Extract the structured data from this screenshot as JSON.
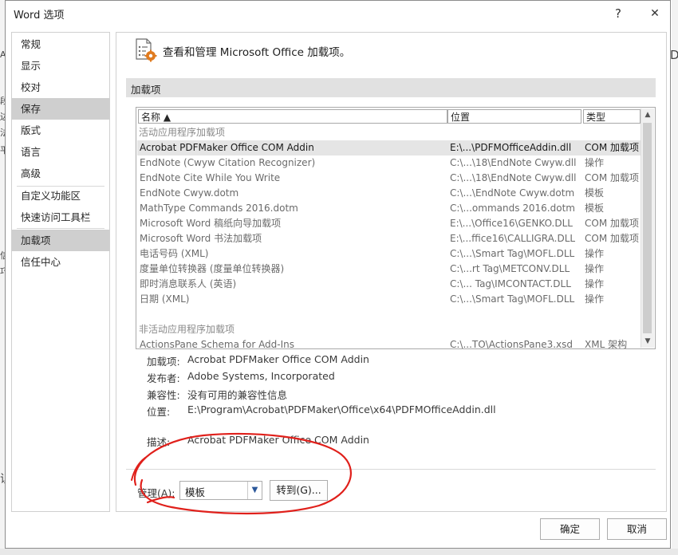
{
  "window": {
    "title": "Word 选项",
    "help": "?",
    "close": "✕"
  },
  "background": {
    "left_glyphs": [
      "A",
      "段",
      "边",
      "法",
      "平",
      "信",
      "巧",
      "识"
    ],
    "right_glyph": "D"
  },
  "sidebar": {
    "items": [
      {
        "label": "常规"
      },
      {
        "label": "显示"
      },
      {
        "label": "校对"
      },
      {
        "label": "保存"
      },
      {
        "label": "版式"
      },
      {
        "label": "语言"
      },
      {
        "label": "高级"
      },
      {
        "label": "自定义功能区"
      },
      {
        "label": "快速访问工具栏"
      },
      {
        "label": "加载项"
      },
      {
        "label": "信任中心"
      }
    ],
    "selected": "加载项"
  },
  "main": {
    "header": "查看和管理 Microsoft Office 加载项。",
    "section": "加载项",
    "columns": {
      "name": "名称 ▲",
      "location": "位置",
      "type": "类型"
    },
    "groups": {
      "active": "活动应用程序加载项",
      "inactive": "非活动应用程序加载项"
    },
    "rows": [
      {
        "name": "Acrobat PDFMaker Office COM Addin",
        "location": "E:\\...\\PDFMOfficeAddin.dll",
        "type": "COM 加载项"
      },
      {
        "name": "EndNote (Cwyw Citation Recognizer)",
        "location": "C:\\...\\18\\EndNote Cwyw.dll",
        "type": "操作"
      },
      {
        "name": "EndNote Cite While You Write",
        "location": "C:\\...\\18\\EndNote Cwyw.dll",
        "type": "COM 加载项"
      },
      {
        "name": "EndNote Cwyw.dotm",
        "location": "C:\\...\\EndNote Cwyw.dotm",
        "type": "模板"
      },
      {
        "name": "MathType Commands 2016.dotm",
        "location": "C:\\...ommands 2016.dotm",
        "type": "模板"
      },
      {
        "name": "Microsoft Word 稿纸向导加载项",
        "location": "E:\\...\\Office16\\GENKO.DLL",
        "type": "COM 加载项"
      },
      {
        "name": "Microsoft Word 书法加载项",
        "location": "E:\\...ffice16\\CALLIGRA.DLL",
        "type": "COM 加载项"
      },
      {
        "name": "电话号码 (XML)",
        "location": "C:\\...\\Smart Tag\\MOFL.DLL",
        "type": "操作"
      },
      {
        "name": "度量单位转换器 (度量单位转换器)",
        "location": "C:\\...rt Tag\\METCONV.DLL",
        "type": "操作"
      },
      {
        "name": "即时消息联系人 (英语)",
        "location": "C:\\... Tag\\IMCONTACT.DLL",
        "type": "操作"
      },
      {
        "name": "日期 (XML)",
        "location": "C:\\...\\Smart Tag\\MOFL.DLL",
        "type": "操作"
      }
    ],
    "inactive_rows": [
      {
        "name": "ActionsPane Schema for Add-Ins",
        "location": "C:\\...TO\\ActionsPane3.xsd",
        "type": "XML 架构"
      }
    ],
    "details": {
      "addin_label": "加载项:",
      "addin_value": "Acrobat PDFMaker Office COM Addin",
      "publisher_label": "发布者:",
      "publisher_value": "Adobe Systems, Incorporated",
      "compat_label": "兼容性:",
      "compat_value": "没有可用的兼容性信息",
      "location_label": "位置:",
      "location_value": "E:\\Program\\Acrobat\\PDFMaker\\Office\\x64\\PDFMOfficeAddin.dll",
      "desc_label": "描述:",
      "desc_value": "Acrobat PDFMaker Office COM Addin"
    },
    "manage": {
      "label": "管理(A):",
      "value": "模板",
      "go": "转到(G)..."
    }
  },
  "footer": {
    "ok": "确定",
    "cancel": "取消"
  },
  "colors": {
    "selected_row": "#e5e5e5",
    "sidebar_selected": "#cfcfcf",
    "annotation": "#e0201b"
  }
}
